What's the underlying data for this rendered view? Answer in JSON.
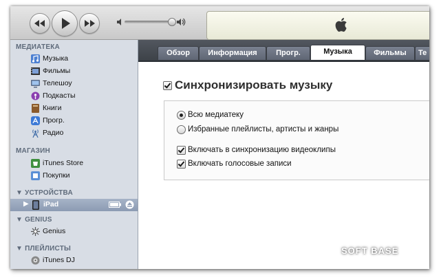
{
  "toolbar": {
    "prev_icon": "rewind-icon",
    "play_icon": "play-icon",
    "next_icon": "fast-forward-icon",
    "volume_level": 0.88,
    "logo_icon": "apple-logo-icon"
  },
  "sidebar": {
    "library": {
      "header": "МЕДИАТЕКА",
      "items": [
        {
          "label": "Музыка",
          "icon": "music-icon"
        },
        {
          "label": "Фильмы",
          "icon": "movies-icon"
        },
        {
          "label": "Телешоу",
          "icon": "tv-icon"
        },
        {
          "label": "Подкасты",
          "icon": "podcast-icon"
        },
        {
          "label": "Книги",
          "icon": "book-icon"
        },
        {
          "label": "Прогр.",
          "icon": "apps-icon"
        },
        {
          "label": "Радио",
          "icon": "radio-icon"
        }
      ]
    },
    "store": {
      "header": "МАГАЗИН",
      "items": [
        {
          "label": "iTunes Store",
          "icon": "store-icon"
        },
        {
          "label": "Покупки",
          "icon": "purchases-icon"
        }
      ]
    },
    "devices": {
      "header": "▼ УСТРОЙСТВА",
      "items": [
        {
          "label": "iPad",
          "icon": "ipad-icon"
        }
      ]
    },
    "genius": {
      "header": "▼ GENIUS",
      "items": [
        {
          "label": "Genius",
          "icon": "genius-icon"
        }
      ]
    },
    "playlists": {
      "header": "▼ ПЛЕЙЛИСТЫ",
      "items": [
        {
          "label": "iTunes DJ",
          "icon": "dj-icon"
        }
      ]
    }
  },
  "tabs": [
    {
      "label": "Обзор",
      "active": false
    },
    {
      "label": "Информация",
      "active": false
    },
    {
      "label": "Прогр.",
      "active": false
    },
    {
      "label": "Музыка",
      "active": true
    },
    {
      "label": "Фильмы",
      "active": false
    },
    {
      "label": "Те",
      "active": false
    }
  ],
  "music": {
    "sync_label": "Синхронизировать музыку",
    "sync_checked": true,
    "options": {
      "entire_library": "Всю медиатеку",
      "selected": "Избранные плейлисты, артисты и жанры",
      "include_videos": "Включать в синхронизацию видеоклипы",
      "include_voice": "Включать голосовые записи"
    }
  },
  "watermark": "SOFT BASE"
}
